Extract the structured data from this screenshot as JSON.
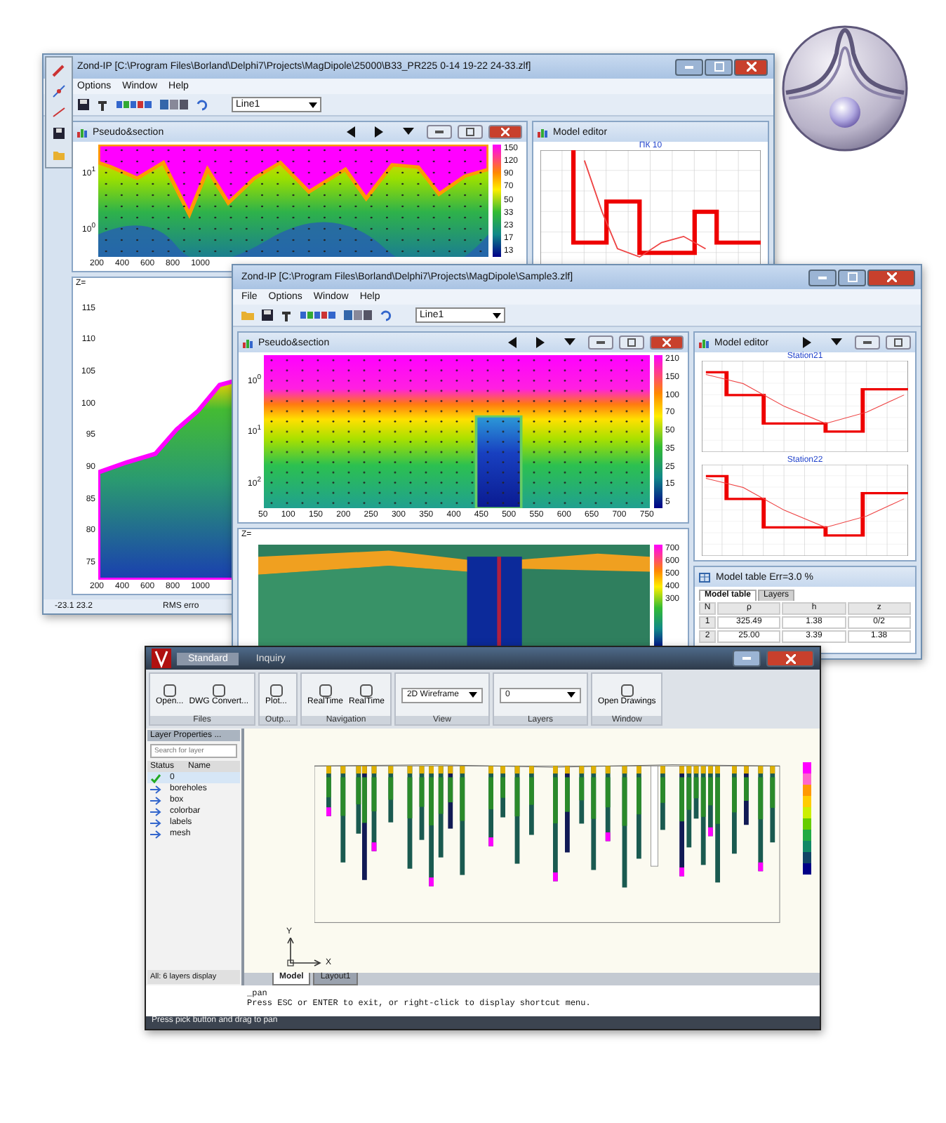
{
  "back_window": {
    "title": "Zond-IP [C:\\Program Files\\Borland\\Delphi7\\Projects\\MagDipole\\25000\\B33_PR225 0-14 19-22 24-33.zlf]",
    "menu": [
      "Options",
      "Window",
      "Help"
    ],
    "line_select": "Line1",
    "pseudosection": {
      "title": "Pseudo&section",
      "y_labels": [
        "10$^{1}$",
        "10$^{0}$"
      ],
      "colorbar_labels": [
        "150",
        "120",
        "90",
        "70",
        "50",
        "33",
        "23",
        "17",
        "13"
      ],
      "x_ticks": [
        "200",
        "400",
        "600",
        "800",
        "1000"
      ]
    },
    "section": {
      "axis_label": "Z=",
      "y_ticks": [
        "115",
        "110",
        "105",
        "100",
        "95",
        "90",
        "85",
        "80",
        "75"
      ],
      "x_ticks": [
        "200",
        "400",
        "600",
        "800",
        "1000"
      ]
    },
    "model_editor": {
      "title": "Model editor",
      "station": "ПК 10"
    },
    "status": [
      "-23.1 23.2",
      "RMS erro"
    ]
  },
  "front_window": {
    "title": "Zond-IP [C:\\Program Files\\Borland\\Delphi7\\Projects\\MagDipole\\Sample3.zlf]",
    "menu": [
      "File",
      "Options",
      "Window",
      "Help"
    ],
    "line_select": "Line1",
    "pseudosection": {
      "title": "Pseudo&section",
      "y_labels": [
        "10$^{0}$",
        "10$^{1}$",
        "10$^{2}$"
      ],
      "colorbar_labels": [
        "210",
        "150",
        "100",
        "70",
        "50",
        "35",
        "25",
        "15",
        "5"
      ],
      "x_ticks": [
        "50",
        "100",
        "150",
        "200",
        "250",
        "300",
        "350",
        "400",
        "450",
        "500",
        "550",
        "600",
        "650",
        "700",
        "750"
      ]
    },
    "section": {
      "axis_label": "Z=",
      "colorbar_labels": [
        "700",
        "600",
        "500",
        "400",
        "300"
      ]
    },
    "model_editor": {
      "title": "Model editor",
      "stations": [
        "Station21",
        "Station22"
      ]
    },
    "model_table": {
      "title": "Model table Err=3.0 %",
      "tabs": [
        {
          "label": "Model table",
          "selected": true
        },
        {
          "label": "Layers",
          "selected": false
        }
      ],
      "columns": [
        "N",
        "ρ",
        "h",
        "z"
      ],
      "rows": [
        [
          "1",
          "325.49",
          "1.38",
          "0/2"
        ],
        [
          "2",
          "25.00",
          "3.39",
          "1.38"
        ]
      ]
    }
  },
  "cad_window": {
    "tabs": [
      {
        "label": "Standard",
        "selected": true
      },
      {
        "label": "Inquiry",
        "selected": false
      }
    ],
    "ribbon": [
      {
        "label": "Files",
        "tools": [
          "Open...",
          "DWG Convert..."
        ]
      },
      {
        "label": "Outp...",
        "tools": [
          "Plot..."
        ]
      },
      {
        "label": "Navigation",
        "tools": [
          "RealTime",
          "RealTime"
        ]
      },
      {
        "label": "View",
        "select": "2D Wireframe"
      },
      {
        "label": "Layers",
        "select": "0"
      },
      {
        "label": "Window",
        "tools": [
          "Open Drawings"
        ]
      }
    ],
    "layer_panel": {
      "title": "Layer Properties ...",
      "placeholder": "Search for layer",
      "columns": [
        "Status",
        "Name"
      ],
      "layers": [
        {
          "name": "0",
          "current": true
        },
        {
          "name": "boreholes",
          "current": false
        },
        {
          "name": "box",
          "current": false
        },
        {
          "name": "colorbar",
          "current": false
        },
        {
          "name": "labels",
          "current": false
        },
        {
          "name": "mesh",
          "current": false
        }
      ],
      "footer": "All: 6 layers display"
    },
    "axes": [
      "Y",
      "X"
    ],
    "layout_tabs": [
      {
        "label": "Model",
        "selected": true
      },
      {
        "label": "Layout1",
        "selected": false
      }
    ],
    "command_lines": [
      "_pan",
      "Press ESC or ENTER to exit, or right-click to display shortcut menu."
    ],
    "status": "Press pick button and drag to pan"
  }
}
